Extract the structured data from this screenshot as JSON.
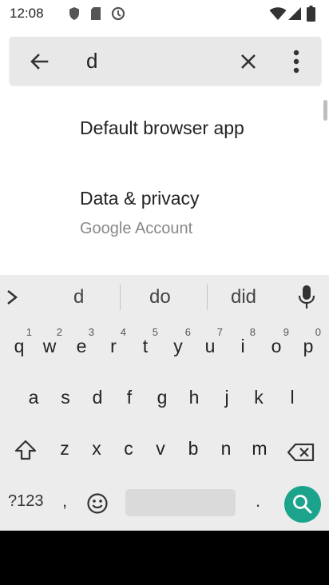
{
  "status_bar": {
    "time": "12:08",
    "icons": [
      "shield-icon",
      "sd-card-icon",
      "sync-icon",
      "wifi-icon",
      "signal-icon",
      "battery-icon"
    ]
  },
  "search": {
    "query": "d",
    "back_icon": "arrow-back-icon",
    "clear_icon": "close-icon",
    "more_icon": "more-vert-icon"
  },
  "results": [
    {
      "title": "Default browser app",
      "subtitle": ""
    },
    {
      "title": "Data & privacy",
      "subtitle": "Google Account"
    }
  ],
  "keyboard": {
    "suggestions": [
      "d",
      "do",
      "did"
    ],
    "rows": [
      [
        {
          "key": "q",
          "hint": "1"
        },
        {
          "key": "w",
          "hint": "2"
        },
        {
          "key": "e",
          "hint": "3"
        },
        {
          "key": "r",
          "hint": "4"
        },
        {
          "key": "t",
          "hint": "5"
        },
        {
          "key": "y",
          "hint": "6"
        },
        {
          "key": "u",
          "hint": "7"
        },
        {
          "key": "i",
          "hint": "8"
        },
        {
          "key": "o",
          "hint": "9"
        },
        {
          "key": "p",
          "hint": "0"
        }
      ],
      [
        {
          "key": "a",
          "hint": ""
        },
        {
          "key": "s",
          "hint": ""
        },
        {
          "key": "d",
          "hint": ""
        },
        {
          "key": "f",
          "hint": ""
        },
        {
          "key": "g",
          "hint": ""
        },
        {
          "key": "h",
          "hint": ""
        },
        {
          "key": "j",
          "hint": ""
        },
        {
          "key": "k",
          "hint": ""
        },
        {
          "key": "l",
          "hint": ""
        }
      ],
      [
        {
          "key": "z",
          "hint": ""
        },
        {
          "key": "x",
          "hint": ""
        },
        {
          "key": "c",
          "hint": ""
        },
        {
          "key": "v",
          "hint": ""
        },
        {
          "key": "b",
          "hint": ""
        },
        {
          "key": "n",
          "hint": ""
        },
        {
          "key": "m",
          "hint": ""
        }
      ]
    ],
    "symbols_label": "?123",
    "comma_label": ",",
    "period_label": ".",
    "accent_color": "#1ba38c"
  }
}
